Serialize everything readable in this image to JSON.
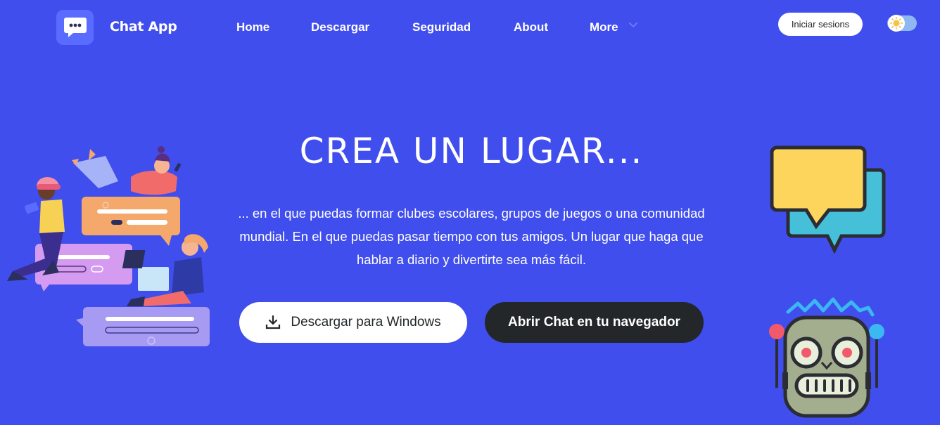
{
  "header": {
    "brand": "Chat App",
    "nav": [
      {
        "label": "Home"
      },
      {
        "label": "Descargar"
      },
      {
        "label": "Seguridad"
      },
      {
        "label": "About"
      },
      {
        "label": "More"
      }
    ],
    "login_label": "Iniciar sesions"
  },
  "hero": {
    "title": "CREA UN LUGAR...",
    "text_lines": [
      "... en el que puedas formar clubes escolares, grupos de juegos o una comunidad",
      "mundial. En el que puedas pasar tiempo con tus amigos. Un lugar que haga que",
      "hablar a diario y divertirte sea más fácil."
    ],
    "download_label": "Descargar para Windows",
    "open_label": "Abrir Chat en tu navegador"
  },
  "colors": {
    "background": "#404eed",
    "dark_button": "#23272a",
    "white": "#ffffff",
    "logo_box": "#5a6bff"
  },
  "icons": {
    "logo": "chat-bubble-icon",
    "more": "chevron-down-icon",
    "toggle": "sun-icon",
    "download": "download-icon"
  }
}
